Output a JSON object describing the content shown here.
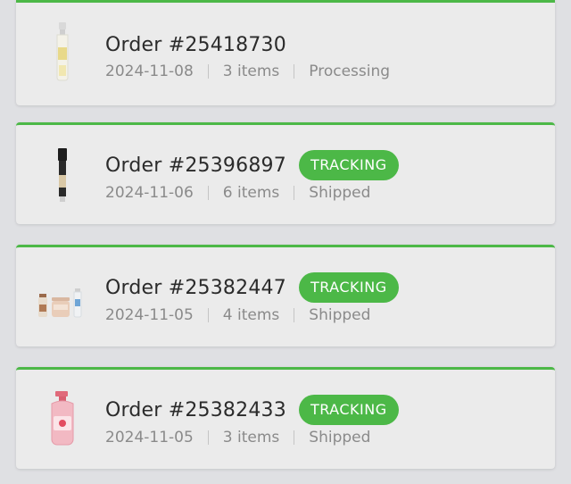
{
  "orders": [
    {
      "title": "Order #25418730",
      "date": "2024-11-08",
      "items": "3 items",
      "status": "Processing",
      "badge": "",
      "thumb_icon": "serum-bottle-icon"
    },
    {
      "title": "Order #25396897",
      "date": "2024-11-06",
      "items": "6 items",
      "status": "Shipped",
      "badge": "TRACKING",
      "thumb_icon": "cream-tube-icon"
    },
    {
      "title": "Order #25382447",
      "date": "2024-11-05",
      "items": "4 items",
      "status": "Shipped",
      "badge": "TRACKING",
      "thumb_icon": "skincare-set-icon"
    },
    {
      "title": "Order #25382433",
      "date": "2024-11-05",
      "items": "3 items",
      "status": "Shipped",
      "badge": "TRACKING",
      "thumb_icon": "lotion-bottle-icon"
    }
  ],
  "colors": {
    "accent": "#4cb847",
    "background": "#dfe0e3",
    "card": "#ebebeb",
    "title_text": "#2b2b2b",
    "meta_text": "#8a8a8a"
  }
}
